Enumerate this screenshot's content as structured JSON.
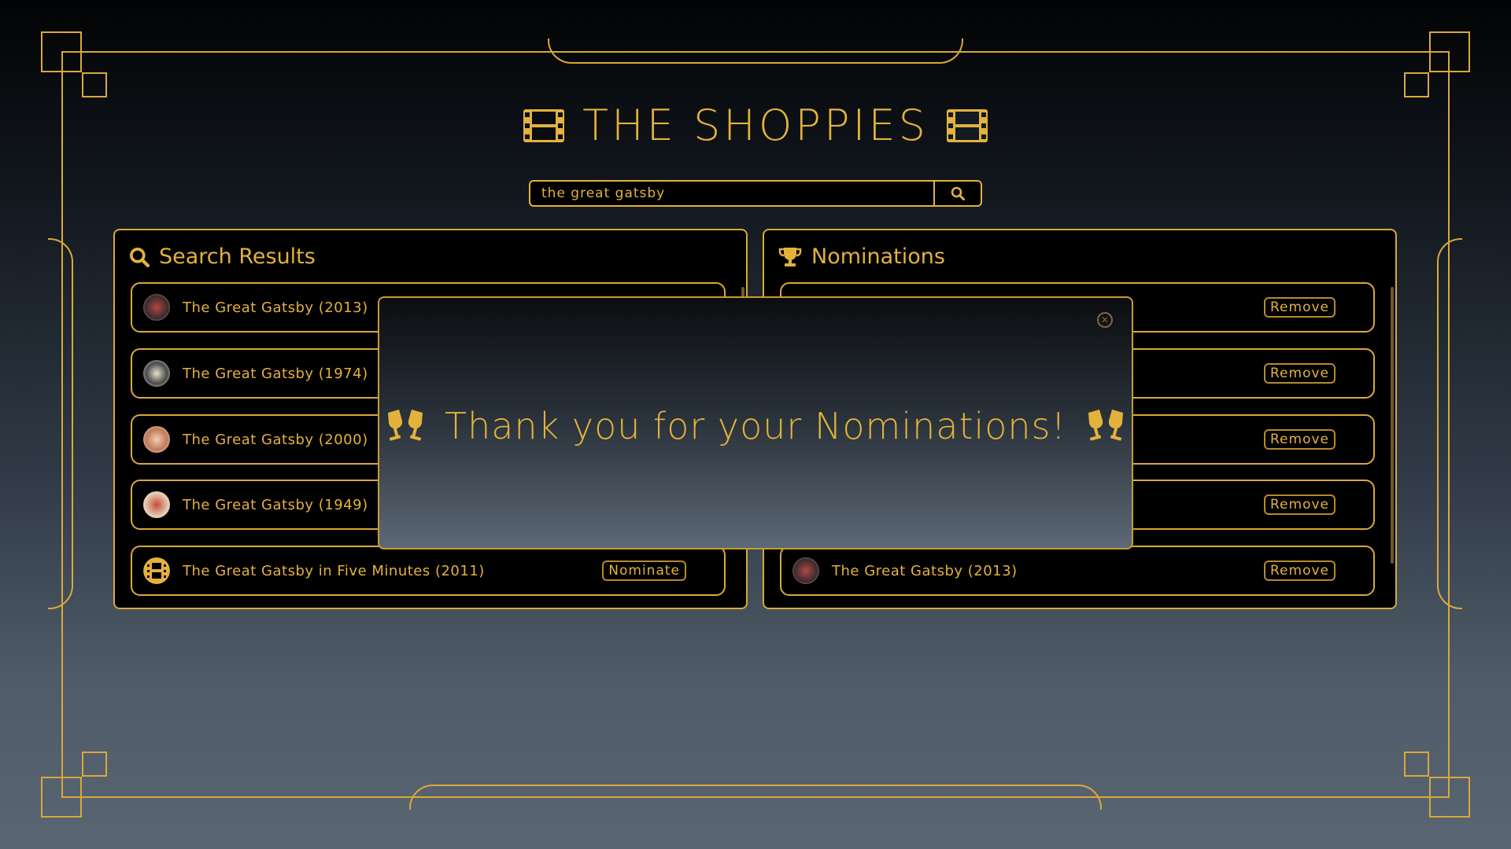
{
  "app": {
    "title": "THE SHOPPIES",
    "title_icon": "film-icon"
  },
  "search": {
    "value": "the great gatsby",
    "icon": "search-icon"
  },
  "results_panel": {
    "heading": "Search Results",
    "icon": "search-icon",
    "items": [
      {
        "title": "The Great Gatsby (2013)"
      },
      {
        "title": "The Great Gatsby (1974)"
      },
      {
        "title": "The Great Gatsby (2000)"
      },
      {
        "title": "The Great Gatsby (1949)"
      },
      {
        "title": "The Great Gatsby in Five Minutes (2011)",
        "action": "Nominate"
      }
    ]
  },
  "nominations_panel": {
    "heading": "Nominations",
    "icon": "trophy-icon",
    "remove_label": "Remove",
    "last_item": {
      "title": "The Great Gatsby (2013)"
    }
  },
  "modal": {
    "message": "Thank you for your Nominations!",
    "icon": "clinking-glasses-icon"
  },
  "colors": {
    "accent": "#e3b23c",
    "panel_bg": "#000000"
  }
}
